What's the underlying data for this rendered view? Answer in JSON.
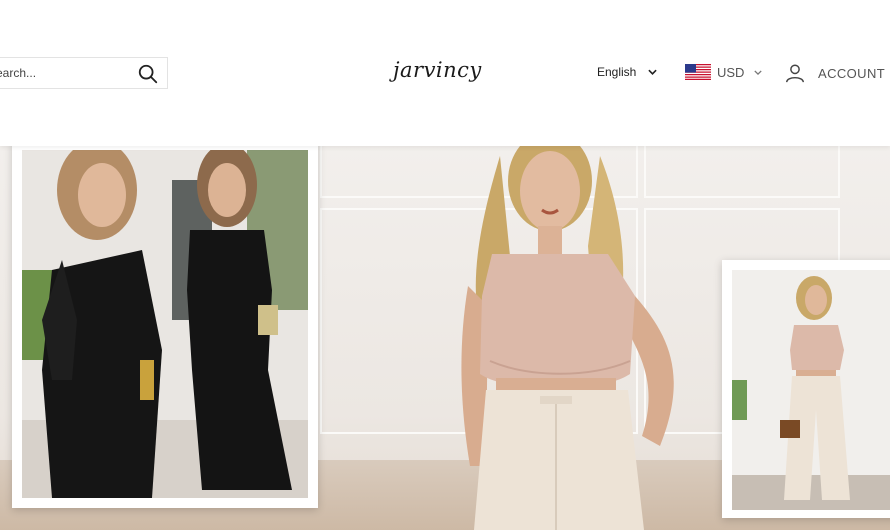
{
  "header": {
    "search_placeholder": "Search...",
    "logo": "jarvincy",
    "language": "English",
    "currency": "USD",
    "account_label": "ACCOUNT"
  },
  "icons": {
    "search": "search-icon",
    "language_dropdown": "chevron-down-icon",
    "currency_flag": "us-flag-icon",
    "currency_dropdown": "chevron-down-icon",
    "account": "user-icon"
  },
  "hero": {
    "images": [
      "black jumpsuit collage",
      "blush top and cream trousers",
      "blush top full-length"
    ]
  },
  "colors": {
    "background": "#ffffff",
    "hero_wall": "#efebe7",
    "top_blush": "#dcb9a9",
    "trousers_cream": "#ede3d6",
    "jumpsuit_black": "#151515"
  }
}
